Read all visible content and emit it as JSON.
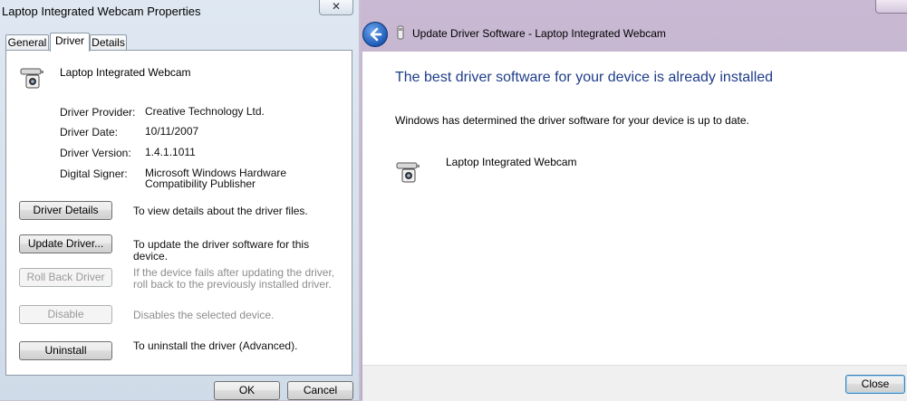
{
  "left_dialog": {
    "title": "Laptop Integrated Webcam Properties",
    "close_glyph": "✕",
    "tabs": [
      "General",
      "Driver",
      "Details"
    ],
    "device_name": "Laptop Integrated Webcam",
    "fields": [
      {
        "label": "Driver Provider:",
        "value": "Creative Technology Ltd."
      },
      {
        "label": "Driver Date:",
        "value": "10/11/2007"
      },
      {
        "label": "Driver Version:",
        "value": "1.4.1.1011"
      },
      {
        "label": "Digital Signer:",
        "value": "Microsoft Windows Hardware Compatibility Publisher"
      }
    ],
    "actions": [
      {
        "button": "Driver Details",
        "description": "To view details about the driver files.",
        "enabled": true
      },
      {
        "button": "Update Driver...",
        "description": "To update the driver software for this device.",
        "enabled": true
      },
      {
        "button": "Roll Back Driver",
        "description": "If the device fails after updating the driver, roll back to the previously installed driver.",
        "enabled": false
      },
      {
        "button": "Disable",
        "description": "Disables the selected device.",
        "enabled": false
      },
      {
        "button": "Uninstall",
        "description": "To uninstall the driver (Advanced).",
        "enabled": true
      }
    ],
    "ok_label": "OK",
    "cancel_label": "Cancel"
  },
  "wizard": {
    "title": "Update Driver Software - Laptop Integrated Webcam",
    "heading": "The best driver software for your device is already installed",
    "message": "Windows has determined the driver software for your device is up to date.",
    "device_name": "Laptop Integrated Webcam",
    "close_label": "Close"
  },
  "colors": {
    "heading_blue": "#1f3d8a",
    "aero_purple": "#c9b9d3",
    "aero_blue": "#dfe8f2"
  }
}
